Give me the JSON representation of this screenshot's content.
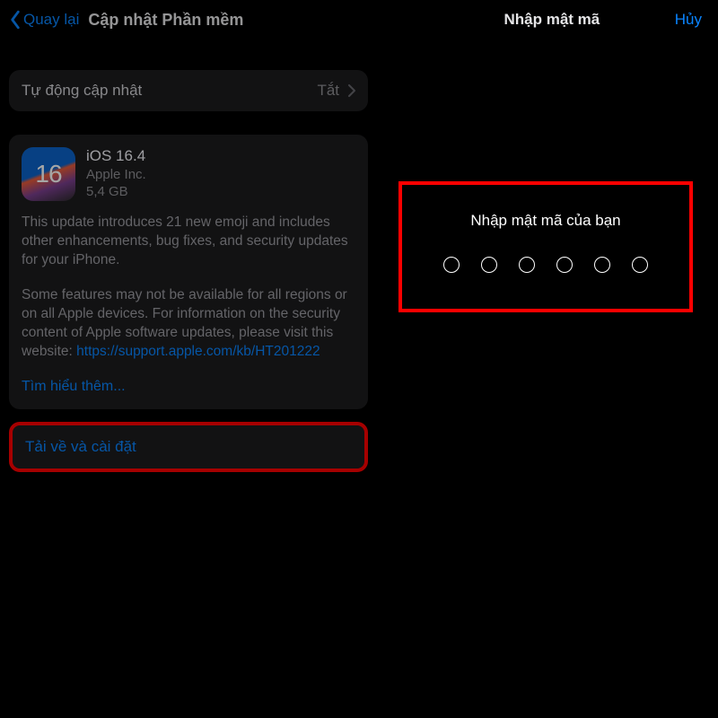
{
  "left": {
    "back_label": "Quay lại",
    "title": "Cập nhật Phần mềm",
    "auto_update": {
      "label": "Tự động cập nhật",
      "value": "Tắt"
    },
    "update": {
      "icon_text": "16",
      "name": "iOS 16.4",
      "vendor": "Apple Inc.",
      "size": "5,4 GB",
      "para1": "This update introduces 21 new emoji and includes other enhancements, bug fixes, and security updates for your iPhone.",
      "para2_a": "Some features may not be available for all regions or on all Apple devices. For information on the security content of Apple software updates, please visit this website: ",
      "link": "https://support.apple.com/kb/HT201222",
      "learn_more": "Tìm hiểu thêm..."
    },
    "install_label": "Tải về và cài đặt"
  },
  "right": {
    "title": "Nhập mật mã",
    "cancel": "Hủy",
    "prompt": "Nhập mật mã của bạn",
    "digits": 6
  },
  "colors": {
    "accent": "#0a84ff",
    "highlight_border": "#ff0000"
  }
}
